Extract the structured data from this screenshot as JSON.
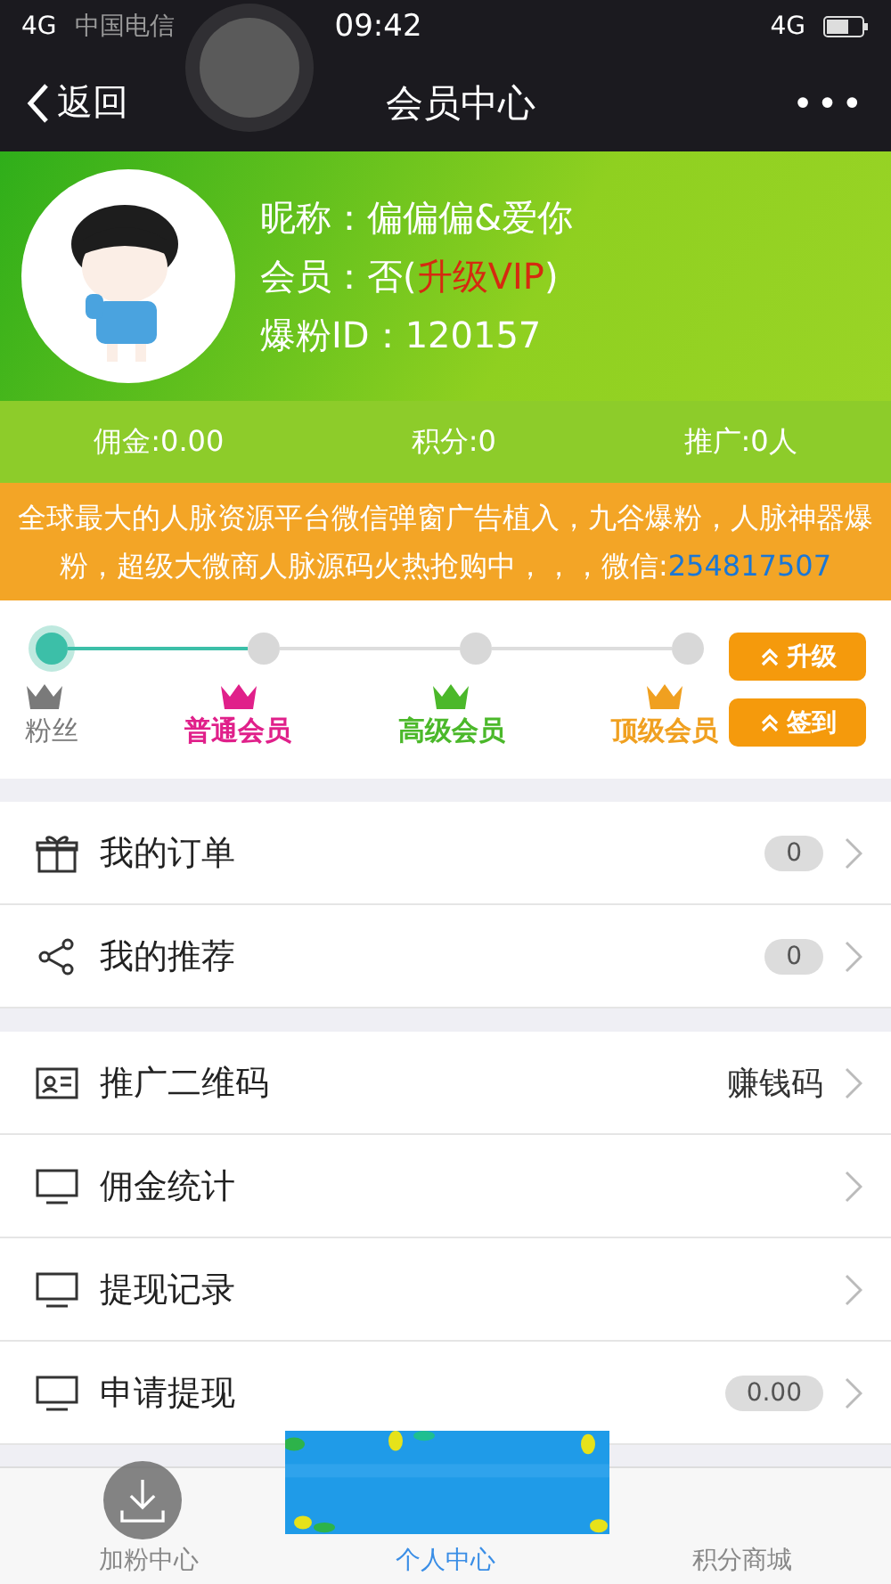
{
  "status_bar": {
    "signal": "4G",
    "carrier": "中国电信",
    "time": "09:42",
    "network": "4G"
  },
  "nav": {
    "back": "返回",
    "title": "会员中心",
    "more": "•••"
  },
  "profile": {
    "avatar": {
      "kind": "picture"
    },
    "nickname_label": "昵称：",
    "nickname": "偏偏偏&爱你",
    "member_label": "会员：",
    "member_value": "否(",
    "upgrade_link": "升级VIP",
    "member_close": ")",
    "id_label": "爆粉ID：",
    "id": "120157"
  },
  "stats": [
    "佣金:0.00",
    "积分:0",
    "推广:0人"
  ],
  "notice": {
    "text": "全球最大的人脉资源平台微信弹窗广告植入，九谷爆粉，人脉神器爆粉，超级大微商人脉源码火热抢购中，，，微信:",
    "link": "254817507"
  },
  "levels": [
    {
      "label": "粉丝",
      "color": "#7a7a7a",
      "selected": true
    },
    {
      "label": "普通会员",
      "color": "#e0208a",
      "selected": false
    },
    {
      "label": "高级会员",
      "color": "#4bb82a",
      "selected": false
    },
    {
      "label": "顶级会员",
      "color": "#f0a020",
      "selected": false
    }
  ],
  "level_buttons": [
    "升级",
    "签到"
  ],
  "menu_groups": [
    [
      {
        "kind": "gift",
        "label": "我的订单",
        "badge": "0"
      },
      {
        "kind": "share",
        "label": "我的推荐",
        "badge": "0"
      }
    ],
    [
      {
        "kind": "card",
        "label": "推广二维码",
        "value": "赚钱码"
      },
      {
        "kind": "monitor",
        "label": "佣金统计"
      },
      {
        "kind": "monitor",
        "label": "提现记录"
      },
      {
        "kind": "monitor",
        "label": "申请提现",
        "badge": "0.00"
      }
    ]
  ],
  "tabs": [
    {
      "label": "加粉中心",
      "selected": false
    },
    {
      "label": "个人中心",
      "selected": true
    },
    {
      "label": "积分商城",
      "selected": false
    }
  ],
  "overlay": {
    "kind": "picture"
  }
}
